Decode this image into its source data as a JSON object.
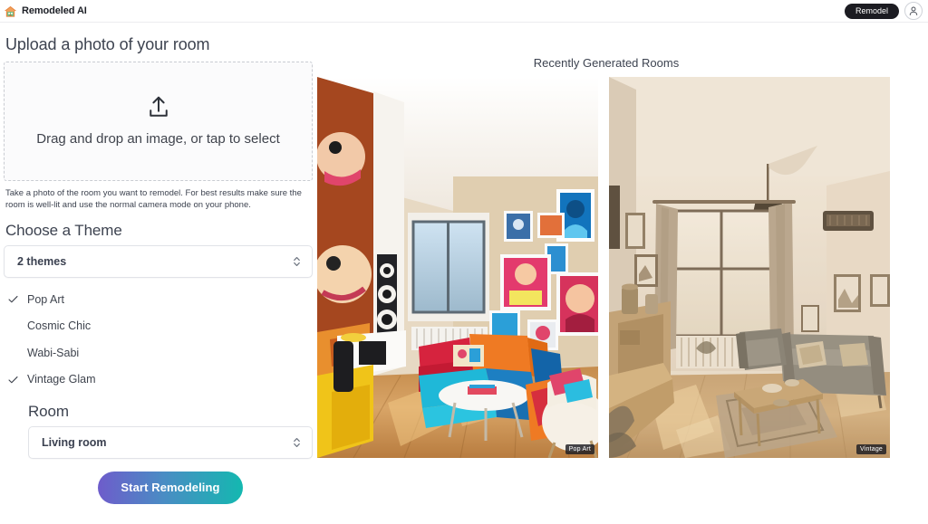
{
  "header": {
    "logo_icon": "house-icon",
    "brand_name": "Remodeled AI",
    "remodel_button": "Remodel",
    "avatar_icon": "user-avatar-icon"
  },
  "upload": {
    "title": "Upload a photo of your room",
    "dropzone_icon": "upload-icon",
    "dropzone_text": "Drag and drop an image, or tap to select",
    "helper_text": "Take a photo of the room you want to remodel. For best results make sure the room is well-lit and use the normal camera mode on your phone."
  },
  "theme": {
    "title": "Choose a Theme",
    "selected_value": "2 themes",
    "chevron_icon": "chevron-up-down-icon",
    "options": [
      {
        "label": "Pop Art",
        "checked": true
      },
      {
        "label": "Cosmic Chic",
        "checked": false
      },
      {
        "label": "Wabi-Sabi",
        "checked": false
      },
      {
        "label": "Vintage Glam",
        "checked": true
      }
    ]
  },
  "room": {
    "title": "Room",
    "selected_value": "Living room",
    "chevron_icon": "chevron-up-down-icon"
  },
  "cta": {
    "label": "Start Remodeling",
    "gradient_from": "#6e5ccb",
    "gradient_to": "#14b8b0"
  },
  "gallery": {
    "title": "Recently Generated Rooms",
    "cards": [
      {
        "badge": "Pop Art",
        "alt": "pop-art-living-room"
      },
      {
        "badge": "Vintage",
        "alt": "vintage-living-room"
      }
    ]
  }
}
